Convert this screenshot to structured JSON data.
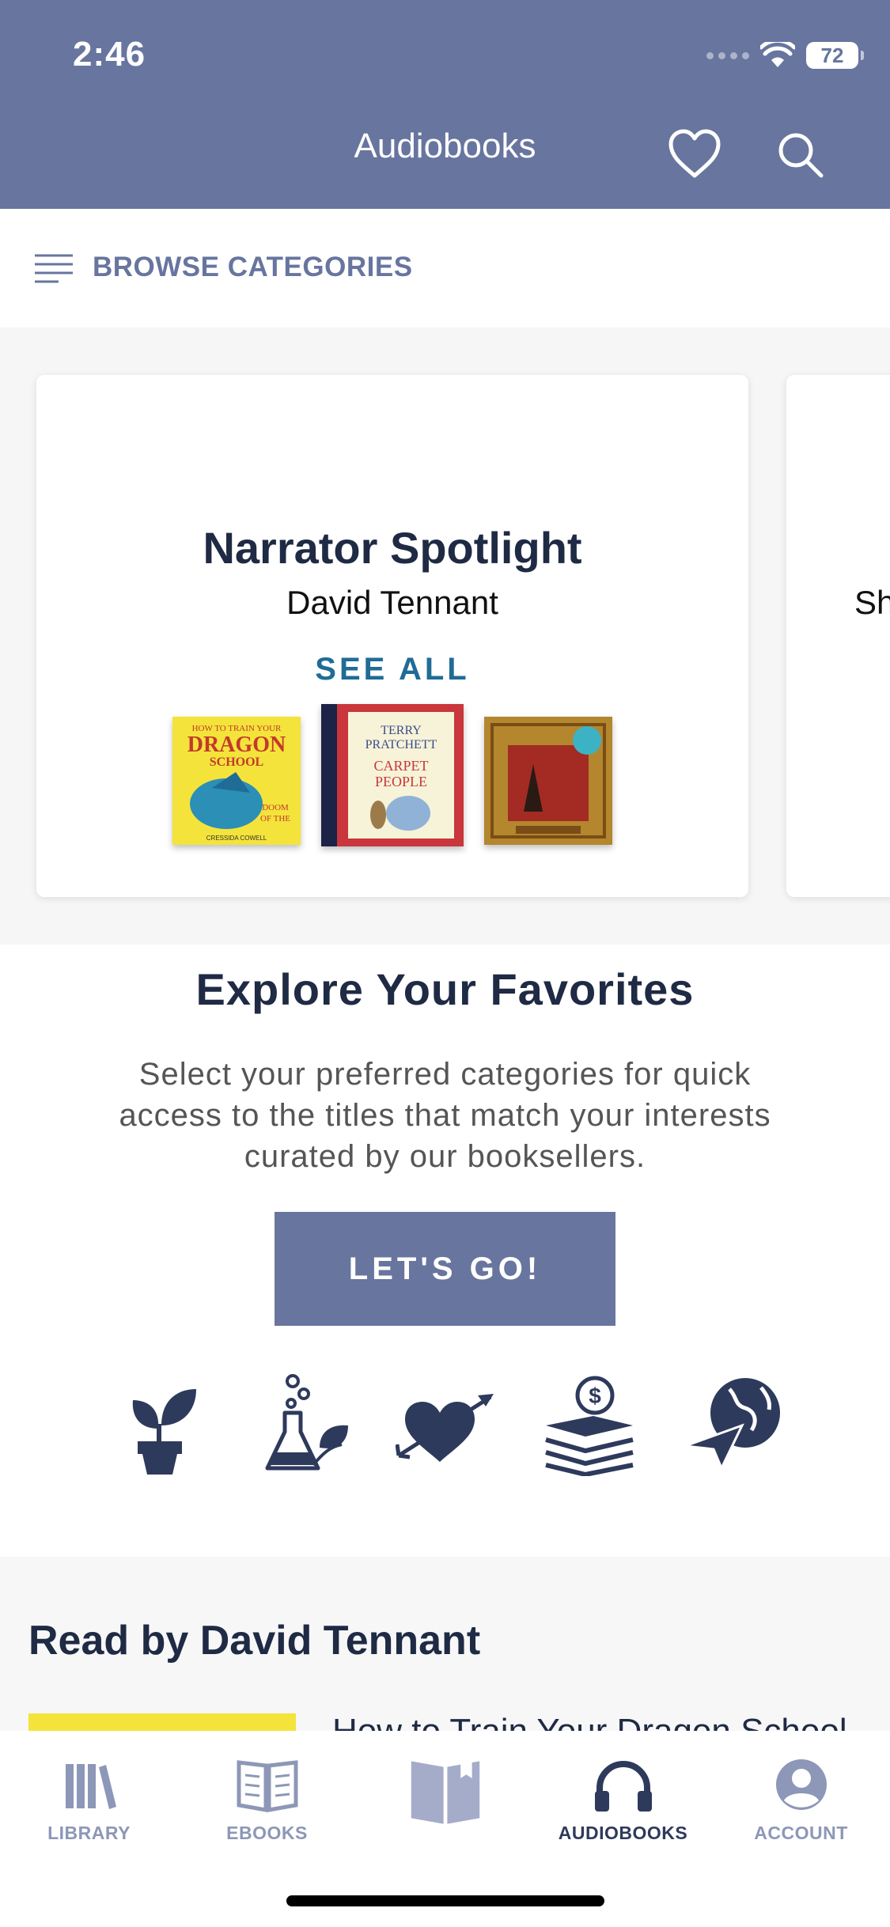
{
  "status_bar": {
    "time": "2:46",
    "battery": "72"
  },
  "header": {
    "title": "Audiobooks",
    "favorites_icon": "heart-icon",
    "search_icon": "search-icon"
  },
  "browse": {
    "label": "BROWSE CATEGORIES",
    "icon": "menu-lines-icon"
  },
  "spotlight": {
    "title": "Narrator Spotlight",
    "narrator": "David Tennant",
    "see_all": "SEE ALL",
    "books": [
      {
        "cover_text": "HOW TO TRAIN YOUR DRAGON SCHOOL",
        "color": "#f4e33b"
      },
      {
        "cover_text": "TERRY PRATCHETT THE CARPET PEOPLE",
        "color": "#c9363b"
      },
      {
        "cover_text": "",
        "color": "#b4862e"
      }
    ],
    "next_card_partial": "Sh"
  },
  "explore": {
    "title": "Explore Your Favorites",
    "description": "Select your preferred categories for quick access to the titles that match your interests curated by our booksellers.",
    "button": "LET'S GO!",
    "category_icons": [
      "plant-icon",
      "science-flask-icon",
      "heart-arrow-icon",
      "books-money-icon",
      "travel-globe-icon"
    ]
  },
  "read_by": {
    "title": "Read by David Tennant",
    "first_item_title": "How to Train Your Dragon School"
  },
  "tabbar": {
    "tabs": [
      {
        "label": "LIBRARY",
        "icon": "library-icon"
      },
      {
        "label": "EBOOKS",
        "icon": "ebook-icon"
      },
      {
        "label": "",
        "icon": "book-bookmark-icon"
      },
      {
        "label": "AUDIOBOOKS",
        "icon": "headphones-icon",
        "active": true
      },
      {
        "label": "ACCOUNT",
        "icon": "account-icon"
      }
    ]
  },
  "colors": {
    "primary": "#67759f",
    "accent_link": "#1f6c96",
    "dark_text": "#1f2a44"
  }
}
